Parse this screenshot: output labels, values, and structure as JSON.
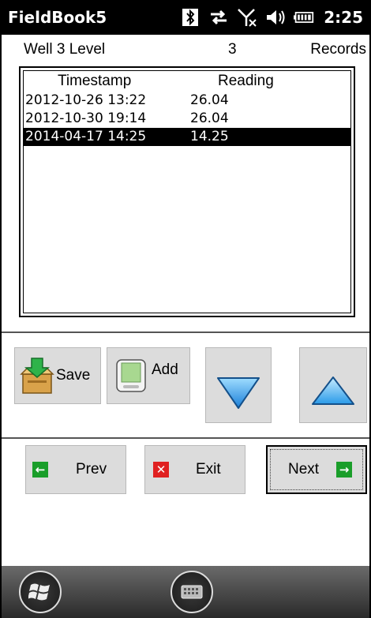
{
  "statusbar": {
    "title": "FieldBook5",
    "time": "2:25",
    "icons": [
      "bluetooth-icon",
      "data-sync-icon",
      "signal-no-service-icon",
      "volume-icon",
      "battery-icon"
    ]
  },
  "header": {
    "name": "Well 3 Level",
    "count": "3",
    "unit": "Records"
  },
  "list": {
    "columns": [
      "Timestamp",
      "Reading"
    ],
    "rows": [
      {
        "timestamp": "2012-10-26 13:22",
        "reading": "26.04",
        "selected": false
      },
      {
        "timestamp": "2012-10-30 19:14",
        "reading": "26.04",
        "selected": false
      },
      {
        "timestamp": "2014-04-17 14:25",
        "reading": "14.25",
        "selected": true
      }
    ]
  },
  "buttons": {
    "save": "Save",
    "add": "Add",
    "prev": "Prev",
    "exit": "Exit",
    "next": "Next"
  },
  "colors": {
    "selection": "#000000",
    "button": "#dcdcdc",
    "arrow_green": "#1a9e2a",
    "exit_red": "#e02020",
    "triangle_blue": "#3fa9f5"
  }
}
